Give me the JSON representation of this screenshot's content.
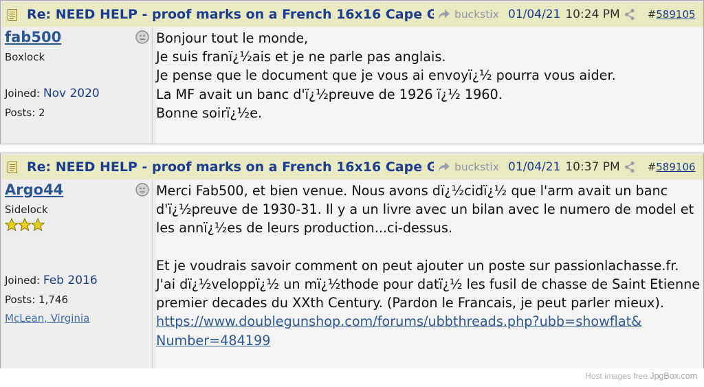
{
  "colors": {
    "link": "#1c3c91",
    "header_bg": "#eaeac2",
    "muted": "#8f959f"
  },
  "posts": [
    {
      "subject": "Re: NEED HELP - proof marks on a French 16x16 Cape G…",
      "reply_to": "buckstix",
      "date": "01/04/21",
      "time": "10:24 PM",
      "hash": "#",
      "post_number": "589105",
      "user": {
        "name": "fab500",
        "rank": "Boxlock",
        "joined_label": "Joined:",
        "joined": "Nov 2020",
        "posts_label": "Posts:",
        "posts": "2"
      },
      "lines": [
        "Bonjour tout le monde,",
        "Je suis franï¿½ais et je ne parle pas anglais.",
        "Je pense que le document que je vous ai envoyï¿½ pourra vous aider.",
        "La MF avait un banc d'ï¿½preuve de 1926 ï¿½ 1960.",
        "Bonne soirï¿½e."
      ]
    },
    {
      "subject": "Re: NEED HELP - proof marks on a French 16x16 Cape G…",
      "reply_to": "buckstix",
      "date": "01/04/21",
      "time": "10:37 PM",
      "hash": "#",
      "post_number": "589106",
      "user": {
        "name": "Argo44",
        "rank": "Sidelock",
        "stars": 3,
        "joined_label": "Joined:",
        "joined": "Feb 2016",
        "posts_label": "Posts:",
        "posts": "1,746",
        "location": "McLean, Virginia"
      },
      "lines": [
        "Merci Fab500, et bien venue. Nous avons dï¿½cidï¿½ que l'arm avait un banc",
        "d'ï¿½preuve de 1930-31. Il y a un livre avec un bilan avec le numero de model et",
        "les annï¿½es de leurs production...ci-dessus.",
        "",
        "Et je voudrais savoir comment on peut ajouter un poste sur passionlachasse.fr.",
        "J'ai dï¿½veloppï¿½ un mï¿½thode pour datï¿½ les fusil de chasse de Saint Etienne des",
        "premier decades du XXth Century. (Pardon le Francais, je peut parler mieux)."
      ],
      "link_lines": [
        "https://www.doublegunshop.com/forums/ubbthreads.php?ubb=showflat&",
        "Number=484199"
      ]
    }
  ],
  "watermark": {
    "text": "Host images free ",
    "brand": "JpgBox.com"
  }
}
